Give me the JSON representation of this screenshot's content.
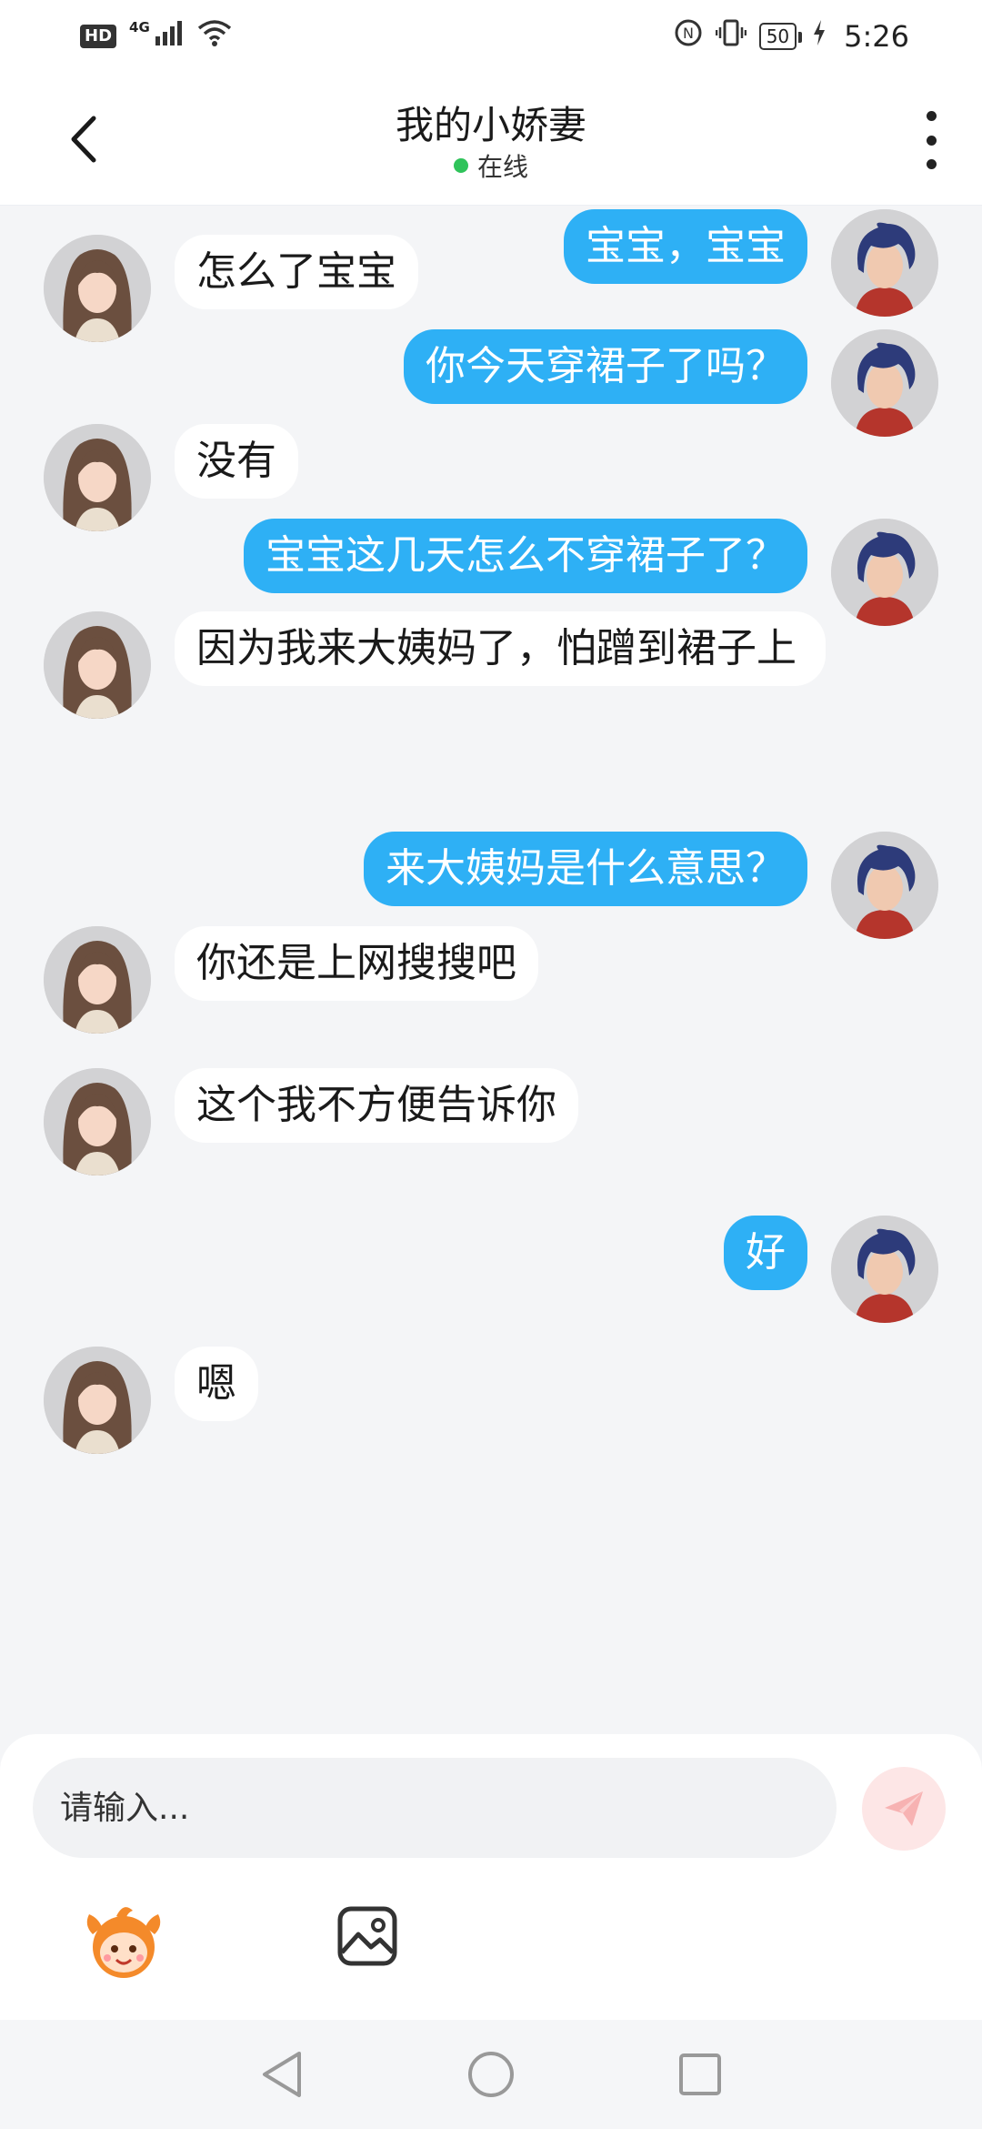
{
  "status_bar": {
    "hd": "HD",
    "network": "4G",
    "battery": "50",
    "time": "5:26"
  },
  "header": {
    "title": "我的小娇妻",
    "status": "在线"
  },
  "messages": [
    {
      "side": "right",
      "text": "宝宝，宝宝",
      "avatar": "male-avatar"
    },
    {
      "side": "left",
      "text": "怎么了宝宝",
      "avatar": "female-avatar"
    },
    {
      "side": "right",
      "text": "你今天穿裙子了吗？",
      "avatar": "male-avatar"
    },
    {
      "side": "left",
      "text": "没有",
      "avatar": "female-avatar"
    },
    {
      "side": "right",
      "text": "宝宝这几天怎么不穿裙子了？",
      "avatar": "male-avatar"
    },
    {
      "side": "left",
      "text": "因为我来大姨妈了，怕蹭到裙子上",
      "avatar": "female-avatar"
    },
    {
      "side": "right",
      "text": "来大姨妈是什么意思？",
      "avatar": "male-avatar"
    },
    {
      "side": "left",
      "text": "你还是上网搜搜吧",
      "avatar": "female-avatar"
    },
    {
      "side": "left",
      "text": "这个我不方便告诉你",
      "avatar": "female-avatar"
    },
    {
      "side": "right",
      "text": "好",
      "avatar": "male-avatar"
    },
    {
      "side": "left",
      "text": "嗯",
      "avatar": "female-avatar"
    }
  ],
  "input": {
    "placeholder": "请输入..."
  },
  "icons": {
    "back": "chevron-left-icon",
    "more": "more-vertical-icon",
    "send": "paper-plane-icon",
    "emoji": "mascot-emoji-icon",
    "image": "image-icon",
    "nav_back": "triangle-back-icon",
    "nav_home": "circle-home-icon",
    "nav_recent": "square-recent-icon"
  },
  "colors": {
    "accent": "#2eb0f5",
    "online": "#2fc35a",
    "send_disabled": "#fde6e6"
  }
}
